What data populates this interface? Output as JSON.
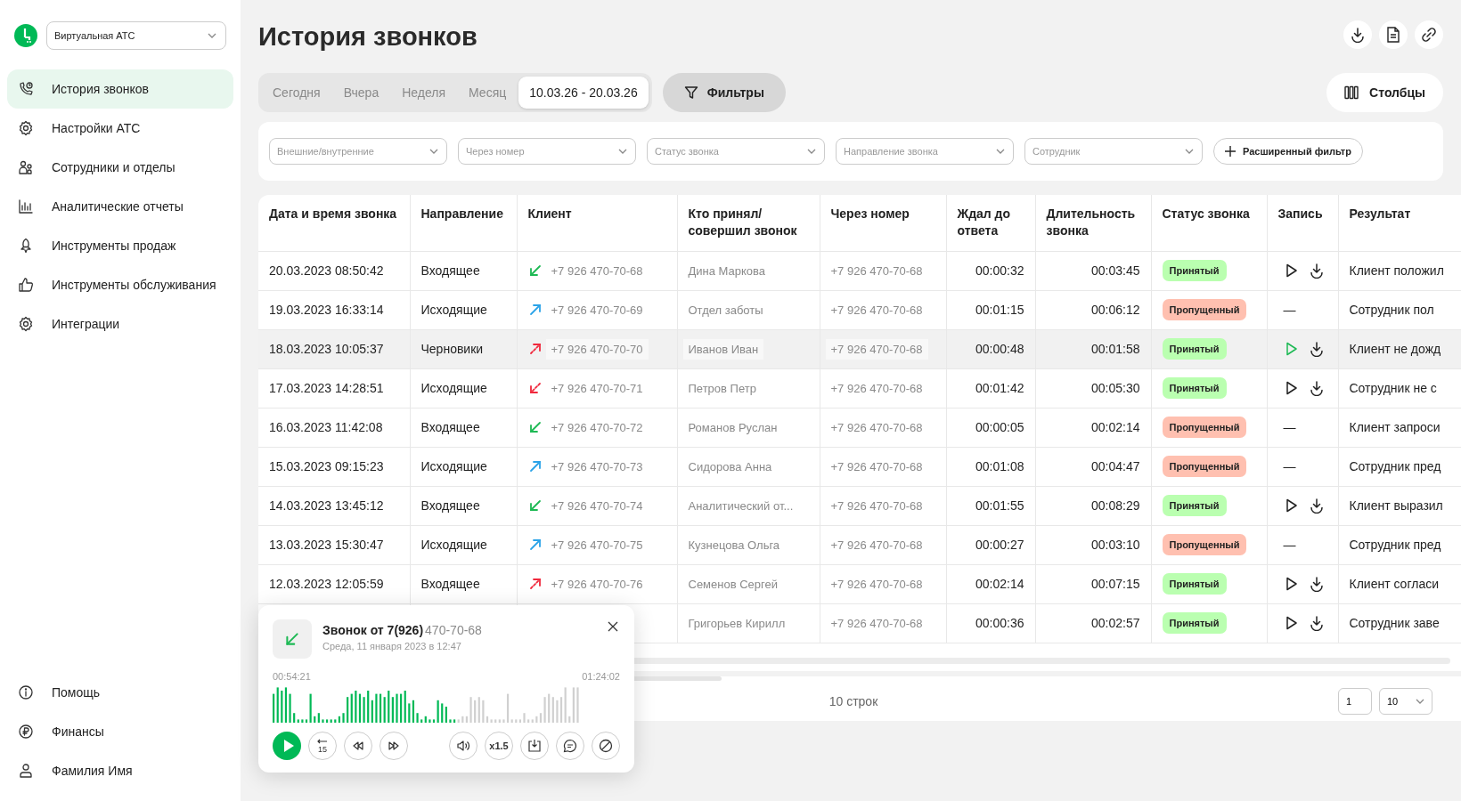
{
  "sidebar": {
    "account_select": "Виртуальная АТС",
    "nav": [
      {
        "label": "История звонков",
        "selected": true
      },
      {
        "label": "Настройки АТС",
        "selected": false
      },
      {
        "label": "Сотрудники и отделы",
        "selected": false
      },
      {
        "label": "Аналитические отчеты",
        "selected": false
      },
      {
        "label": "Инструменты продаж",
        "selected": false
      },
      {
        "label": "Инструменты обслуживания",
        "selected": false
      },
      {
        "label": "Интеграции",
        "selected": false
      }
    ],
    "bottom": [
      {
        "label": "Помощь"
      },
      {
        "label": "Финансы"
      },
      {
        "label": "Фамилия Имя"
      }
    ]
  },
  "title": "История звонков",
  "periods": [
    {
      "label": "Сегодня",
      "selected": false
    },
    {
      "label": "Вчера",
      "selected": false
    },
    {
      "label": "Неделя",
      "selected": false
    },
    {
      "label": "Месяц",
      "selected": false
    },
    {
      "label": "10.03.26 - 20.03.26",
      "selected": true
    }
  ],
  "filters_button": "Фильтры",
  "columns_button": "Столбцы",
  "filters": [
    {
      "placeholder": "Внешние/внутренние"
    },
    {
      "placeholder": "Через номер"
    },
    {
      "placeholder": "Статус звонка"
    },
    {
      "placeholder": "Направление звонка"
    },
    {
      "placeholder": "Сотрудник"
    }
  ],
  "advanced_filter": "Расширенный фильтр",
  "table": {
    "columns": [
      "Дата и время звонка",
      "Направление",
      "Клиент",
      "Кто принял/ совершил звонок",
      "Через номер",
      "Ждал до ответа",
      "Длительность звонка",
      "Статус звонка",
      "Запись",
      "Результат"
    ],
    "rows": [
      {
        "date": "20.03.2023 08:50:42",
        "direction": "Входящее",
        "kind": "incoming",
        "client": "+7 926 470-70-68",
        "agent": "Дина Маркова",
        "via": "+7 926 470-70-68",
        "wait": "00:00:32",
        "duration": "00:03:45",
        "status": {
          "label": "Принятый",
          "kind": "accepted"
        },
        "has_recording": true,
        "playing": false,
        "result": "Клиент положил",
        "highlighted": false
      },
      {
        "date": "19.03.2023 16:33:14",
        "direction": "Исходящие",
        "kind": "outgoing",
        "client": "+7 926 470-70-69",
        "agent": "Отдел заботы",
        "via": "+7 926 470-70-68",
        "wait": "00:01:15",
        "duration": "00:06:12",
        "status": {
          "label": "Пропущенный",
          "kind": "missed"
        },
        "has_recording": false,
        "record": "—",
        "result": "Сотрудник пол",
        "highlighted": false
      },
      {
        "date": "18.03.2023 10:05:37",
        "direction": "Черновики",
        "kind": "failed_out",
        "client": "+7 926 470-70-70",
        "agent": "Иванов Иван",
        "via": "+7 926 470-70-68",
        "wait": "00:00:48",
        "duration": "00:01:58",
        "status": {
          "label": "Принятый",
          "kind": "accepted"
        },
        "has_recording": true,
        "playing": true,
        "result": "Клиент не дожд",
        "highlighted": true
      },
      {
        "date": "17.03.2023 14:28:51",
        "direction": "Исходящие",
        "kind": "failed_in",
        "client": "+7 926 470-70-71",
        "agent": "Петров Петр",
        "via": "+7 926 470-70-68",
        "wait": "00:01:42",
        "duration": "00:05:30",
        "status": {
          "label": "Принятый",
          "kind": "accepted"
        },
        "has_recording": true,
        "playing": false,
        "result": "Сотрудник не с",
        "highlighted": false
      },
      {
        "date": "16.03.2023 11:42:08",
        "direction": "Входящее",
        "kind": "incoming",
        "client": "+7 926 470-70-72",
        "agent": "Романов Руслан",
        "via": "+7 926 470-70-68",
        "wait": "00:00:05",
        "duration": "00:02:14",
        "status": {
          "label": "Пропущенный",
          "kind": "missed"
        },
        "has_recording": false,
        "record": "—",
        "result": "Клиент запроси",
        "highlighted": false
      },
      {
        "date": "15.03.2023 09:15:23",
        "direction": "Исходящие",
        "kind": "outgoing",
        "client": "+7 926 470-70-73",
        "agent": "Сидорова Анна",
        "via": "+7 926 470-70-68",
        "wait": "00:01:08",
        "duration": "00:04:47",
        "status": {
          "label": "Пропущенный",
          "kind": "missed"
        },
        "has_recording": false,
        "record": "—",
        "result": "Сотрудник пред",
        "highlighted": false
      },
      {
        "date": "14.03.2023 13:45:12",
        "direction": "Входящее",
        "kind": "incoming",
        "client": "+7 926 470-70-74",
        "agent": "Аналитический от...",
        "via": "+7 926 470-70-68",
        "wait": "00:01:55",
        "duration": "00:08:29",
        "status": {
          "label": "Принятый",
          "kind": "accepted"
        },
        "has_recording": true,
        "playing": false,
        "result": "Клиент выразил",
        "highlighted": false
      },
      {
        "date": "13.03.2023 15:30:47",
        "direction": "Исходящие",
        "kind": "outgoing",
        "client": "+7 926 470-70-75",
        "agent": "Кузнецова Ольга",
        "via": "+7 926 470-70-68",
        "wait": "00:00:27",
        "duration": "00:03:10",
        "status": {
          "label": "Пропущенный",
          "kind": "missed"
        },
        "has_recording": false,
        "record": "—",
        "result": "Сотрудник пред",
        "highlighted": false
      },
      {
        "date": "12.03.2023 12:05:59",
        "direction": "Входящее",
        "kind": "failed_out",
        "client": "+7 926 470-70-76",
        "agent": "Семенов Сергей",
        "via": "+7 926 470-70-68",
        "wait": "00:02:14",
        "duration": "00:07:15",
        "status": {
          "label": "Принятый",
          "kind": "accepted"
        },
        "has_recording": true,
        "playing": false,
        "result": "Клиент согласи",
        "highlighted": false
      },
      {
        "agent": "Григорьев Кирилл",
        "via": "+7 926 470-70-68",
        "wait": "00:00:36",
        "duration": "00:02:57",
        "status": {
          "label": "Принятый",
          "kind": "accepted"
        },
        "has_recording": true,
        "playing": false,
        "result": "Сотрудник заве",
        "highlighted": false
      }
    ]
  },
  "footer": {
    "row_count": "10 строк",
    "page": "1",
    "per_page": "10"
  },
  "player": {
    "kind": "incoming",
    "title": "Звонок от 7(926)",
    "hidden_number": "470-70-68",
    "date": "Среда, 11 января 2023 в 12:47",
    "elapsed": "00:54:21",
    "total": "01:24:02",
    "level": 0.6,
    "skip_label": "15",
    "speed": "x1.5"
  }
}
